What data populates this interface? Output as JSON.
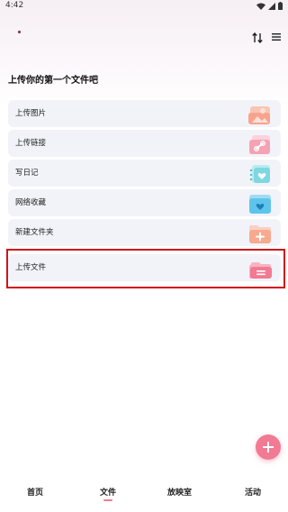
{
  "status": {
    "time": "4:42"
  },
  "section_title": "上传你的第一个文件吧",
  "items": [
    {
      "label": "上传图片",
      "icon": "image-upload-icon"
    },
    {
      "label": "上传链接",
      "icon": "link-icon"
    },
    {
      "label": "写日记",
      "icon": "diary-icon"
    },
    {
      "label": "网络收藏",
      "icon": "web-favorite-icon"
    },
    {
      "label": "新建文件夹",
      "icon": "new-folder-icon"
    },
    {
      "label": "上传文件",
      "icon": "file-upload-icon"
    }
  ],
  "tabs": [
    "首页",
    "文件",
    "放映室",
    "活动"
  ],
  "active_tab": "文件",
  "colors": {
    "accent": "#f27a92",
    "highlight_border": "#d0111a",
    "item_bg": "#f2f3f8"
  }
}
